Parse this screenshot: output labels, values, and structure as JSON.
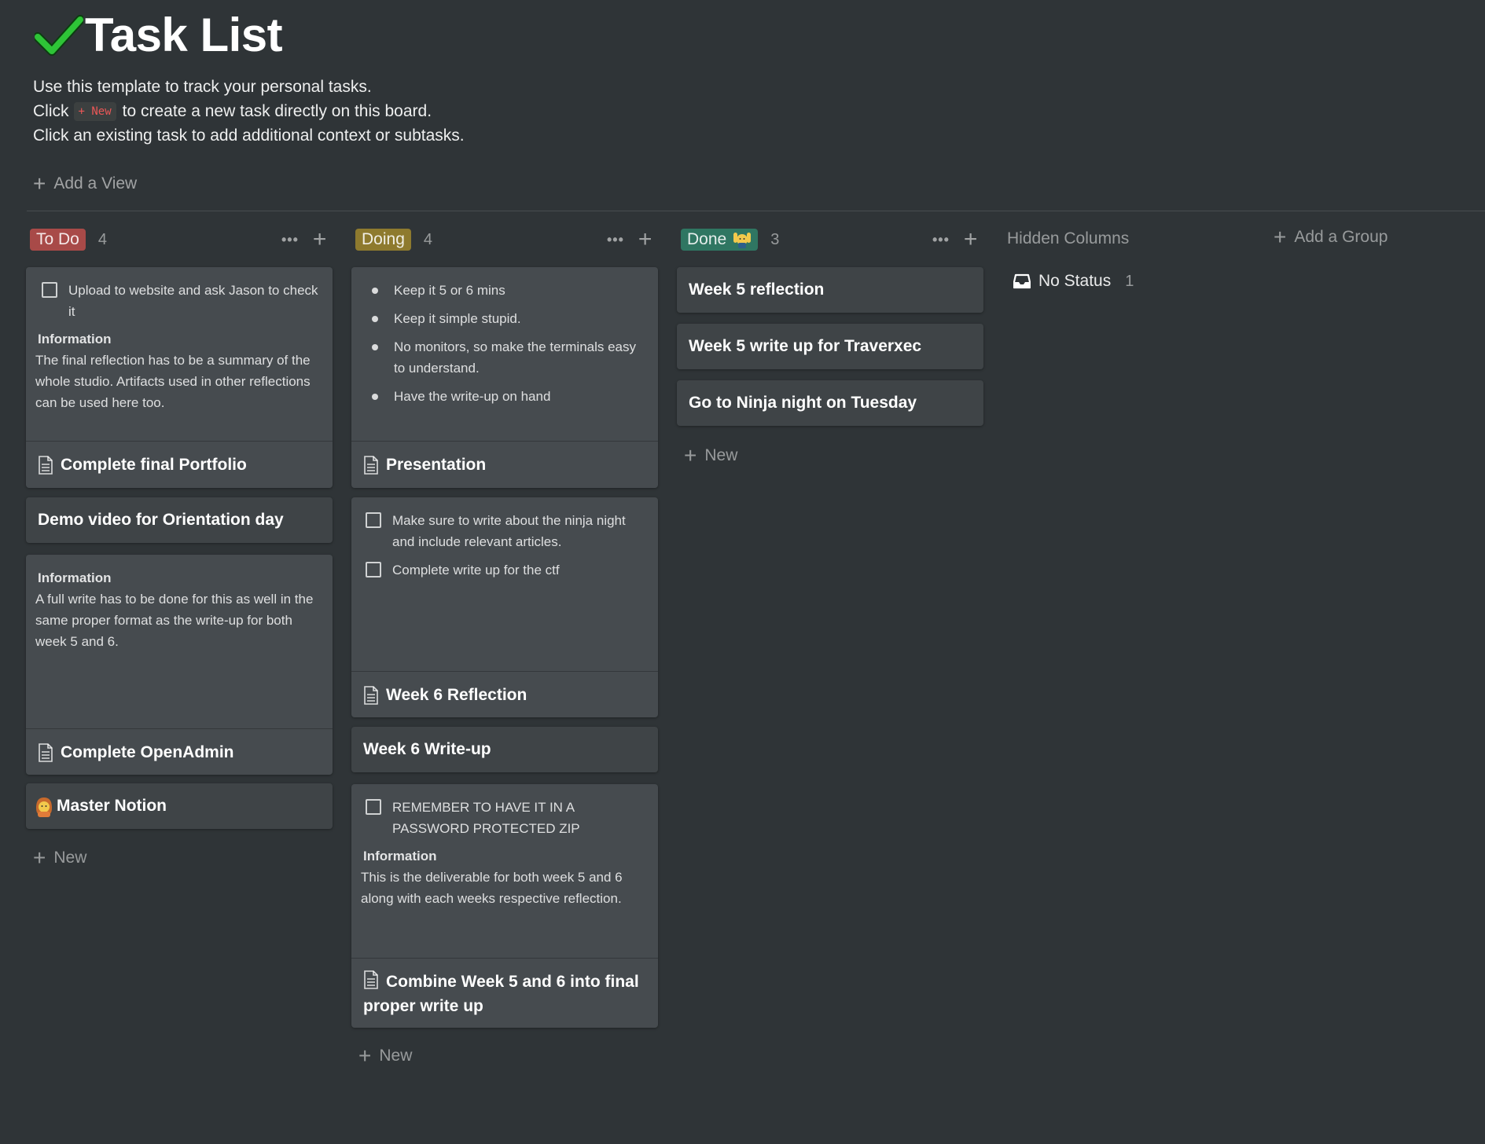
{
  "page": {
    "title": "Task List",
    "title_icon": "green-check-icon",
    "description": {
      "line1": "Use this template to track your personal tasks.",
      "line2_before": "Click",
      "line2_code": "+ New",
      "line2_after": "to create a new task directly on this board.",
      "line3": "Click an existing task to add additional context or subtasks."
    },
    "add_view": "Add a View"
  },
  "columns": {
    "todo": {
      "label": "To Do",
      "count": "4",
      "color": "#a84a48",
      "new_label": "New",
      "cards": {
        "c1": {
          "checkbox": "Upload to website and ask Jason to check it",
          "info_heading": "Information",
          "info_text": "The final reflection has to be a summary of the whole studio. Artifacts used in other reflections can be used here too.",
          "title": "Complete final Portfolio"
        },
        "c2": {
          "title": "Demo video for Orientation day"
        },
        "c3": {
          "info_heading": "Information",
          "info_text": "A full write has to be done for this as well in the same proper format as the write-up for both week 5 and 6.",
          "title": "Complete OpenAdmin"
        },
        "c4": {
          "icon": "person-emoji-icon",
          "title": "Master Notion"
        }
      }
    },
    "doing": {
      "label": "Doing",
      "count": "4",
      "color": "#8e7a2e",
      "new_label": "New",
      "cards": {
        "c1": {
          "bullets": [
            "Keep it 5 or 6 mins",
            "Keep it simple stupid.",
            "No monitors, so make the terminals easy to understand.",
            "Have the write-up on hand"
          ],
          "title": "Presentation"
        },
        "c2": {
          "checkbox1": "Make sure to write about the ninja night and include relevant articles.",
          "checkbox2": "Complete write up for the ctf",
          "title": "Week 6 Reflection"
        },
        "c3": {
          "title": "Week 6 Write-up"
        },
        "c4": {
          "checkbox": "REMEMBER TO HAVE IT IN A PASSWORD PROTECTED ZIP",
          "info_heading": "Information",
          "info_text": "This is the deliverable for both week 5 and 6 along with each weeks respective reflection.",
          "title": "Combine Week 5 and 6 into final proper write up"
        }
      }
    },
    "done": {
      "label": "Done",
      "icon": "raised-hands-emoji-icon",
      "count": "3",
      "color": "#2f7662",
      "new_label": "New",
      "cards": {
        "c1": {
          "title": "Week 5 reflection"
        },
        "c2": {
          "title": "Week 5 write up for Traverxec"
        },
        "c3": {
          "title": "Go to Ninja night on Tuesday"
        }
      }
    }
  },
  "hidden_columns": {
    "label": "Hidden Columns",
    "items": [
      {
        "label": "No Status",
        "count": "1",
        "icon": "inbox-icon"
      }
    ]
  },
  "add_group": "Add a Group"
}
